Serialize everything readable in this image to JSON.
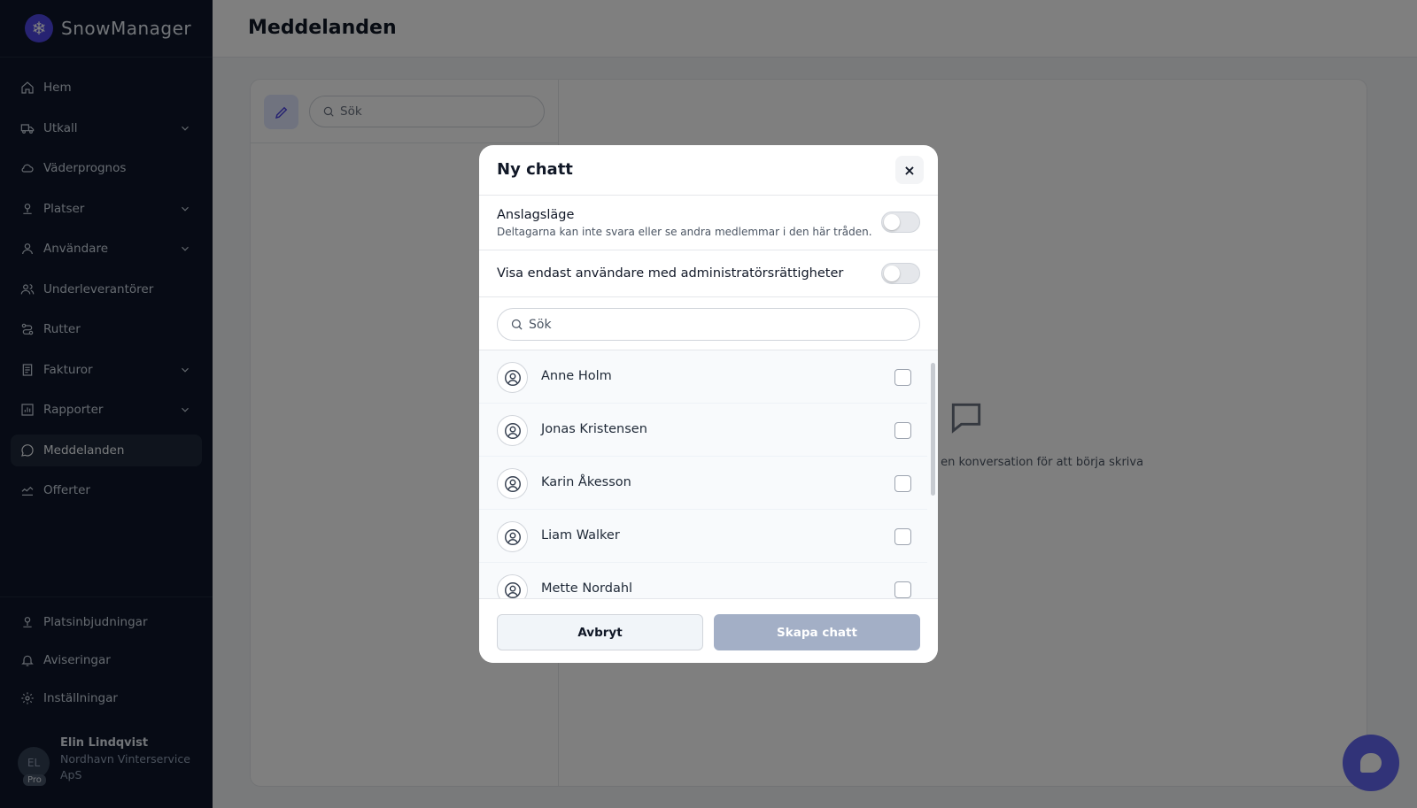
{
  "app": {
    "name": "SnowManager"
  },
  "sidebar": {
    "items": [
      {
        "label": "Hem",
        "icon": "home-icon",
        "expandable": false,
        "active": false
      },
      {
        "label": "Utkall",
        "icon": "truck-icon",
        "expandable": true,
        "active": false
      },
      {
        "label": "Väderprognos",
        "icon": "cloud-icon",
        "expandable": false,
        "active": false
      },
      {
        "label": "Platser",
        "icon": "location-icon",
        "expandable": true,
        "active": false
      },
      {
        "label": "Användare",
        "icon": "user-icon",
        "expandable": true,
        "active": false
      },
      {
        "label": "Underleverantörer",
        "icon": "users-icon",
        "expandable": false,
        "active": false
      },
      {
        "label": "Rutter",
        "icon": "route-icon",
        "expandable": false,
        "active": false
      },
      {
        "label": "Fakturor",
        "icon": "invoice-icon",
        "expandable": true,
        "active": false
      },
      {
        "label": "Rapporter",
        "icon": "chart-icon",
        "expandable": true,
        "active": false
      },
      {
        "label": "Meddelanden",
        "icon": "message-icon",
        "expandable": false,
        "active": true
      },
      {
        "label": "Offerter",
        "icon": "offer-icon",
        "expandable": false,
        "active": false
      }
    ],
    "bottom_items": [
      {
        "label": "Platsinbjudningar",
        "icon": "location-icon"
      },
      {
        "label": "Aviseringar",
        "icon": "bell-icon"
      },
      {
        "label": "Inställningar",
        "icon": "gear-icon"
      }
    ],
    "user": {
      "initials": "EL",
      "badge": "Pro",
      "name": "Elin Lindqvist",
      "org": "Nordhavn Vinterservice ApS"
    }
  },
  "header": {
    "title": "Meddelanden"
  },
  "messages": {
    "search_placeholder": "Sök",
    "empty_text": "Välj en konversation för att börja skriva"
  },
  "modal": {
    "title": "Ny chatt",
    "close_label": "×",
    "broadcast": {
      "label": "Anslagsläge",
      "description": "Deltagarna kan inte svara eller se andra medlemmar i den här tråden.",
      "enabled": false
    },
    "admin_only": {
      "label": "Visa endast användare med administratörsrättigheter",
      "enabled": false
    },
    "search_placeholder": "Sök",
    "users": [
      {
        "name": "Anne Holm",
        "checked": false
      },
      {
        "name": "Jonas Kristensen",
        "checked": false
      },
      {
        "name": "Karin Åkesson",
        "checked": false
      },
      {
        "name": "Liam Walker",
        "checked": false
      },
      {
        "name": "Mette Nordahl",
        "checked": false
      }
    ],
    "cancel_label": "Avbryt",
    "create_label": "Skapa chatt"
  },
  "colors": {
    "sidebar_bg": "#0f172a",
    "accent": "#6366f1",
    "create_disabled": "#a3afc6"
  }
}
